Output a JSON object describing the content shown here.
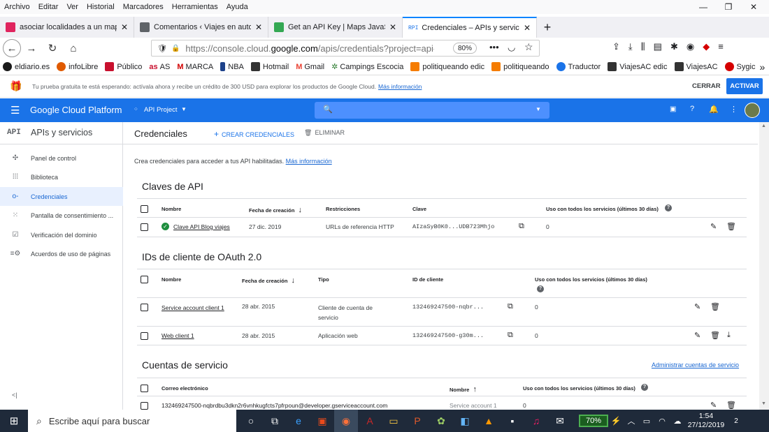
{
  "menubar": [
    "Archivo",
    "Editar",
    "Ver",
    "Historial",
    "Marcadores",
    "Herramientas",
    "Ayuda"
  ],
  "tabs": [
    {
      "label": "asociar localidades a un mapa d",
      "icon": "wp-icon",
      "color": "#e0245e"
    },
    {
      "label": "Comentarios ‹ Viajes en autoca",
      "icon": "blog-icon",
      "color": "#5f6368"
    },
    {
      "label": "Get an API Key  |  Maps JavaScr",
      "icon": "maps-icon",
      "color": "#34a853"
    },
    {
      "label": "Credenciales – APIs y servicios",
      "icon": "api-icon",
      "color": "#1a73e8",
      "prefix": "RPI"
    }
  ],
  "url": {
    "prefix": "https://console.cloud.",
    "domain": "google.com",
    "rest": "/apis/credentials?project=api-pro"
  },
  "zoom": "80%",
  "bookmarks": [
    {
      "label": "eldiario.es",
      "color": "#1a1a1a"
    },
    {
      "label": "infoLibre",
      "color": "#e05a00"
    },
    {
      "label": "Público",
      "color": "#c8102e"
    },
    {
      "label": "AS",
      "color": "#c8102e",
      "prefix": "as"
    },
    {
      "label": "MARCA",
      "color": "#d10000"
    },
    {
      "label": "NBA",
      "color": "#1d428a"
    },
    {
      "label": "Hotmail",
      "color": "#333"
    },
    {
      "label": "Gmail",
      "color": "#ea4335"
    },
    {
      "label": "Campings Escocia",
      "color": "#2e7d32"
    },
    {
      "label": "politiqueando edic",
      "color": "#f57c00"
    },
    {
      "label": "politiqueando",
      "color": "#f57c00"
    },
    {
      "label": "Traductor",
      "color": "#1a73e8"
    },
    {
      "label": "ViajesAC edic",
      "color": "#333"
    },
    {
      "label": "ViajesAC",
      "color": "#333"
    },
    {
      "label": "Sygic",
      "color": "#d50000"
    }
  ],
  "trial": {
    "text": "Tu prueba gratuita te está esperando: actívala ahora y recibe un crédito de 300 USD para explorar los productos de Google Cloud.",
    "link": "Más información",
    "close": "CERRAR",
    "activate": "ACTIVAR"
  },
  "gcp": {
    "brand": "Google Cloud Platform",
    "project": "API Project"
  },
  "sidebar": {
    "badge": "API",
    "title": "APIs y servicios",
    "items": [
      {
        "label": "Panel de control",
        "icon": "✣"
      },
      {
        "label": "Biblioteca",
        "icon": "⁞⁞⁞"
      },
      {
        "label": "Credenciales",
        "icon": "o-"
      },
      {
        "label": "Pantalla de consentimiento ...",
        "icon": "⁙"
      },
      {
        "label": "Verificación del dominio",
        "icon": "☑"
      },
      {
        "label": "Acuerdos de uso de páginas",
        "icon": "≡⚙"
      }
    ],
    "collapse": "<|"
  },
  "main": {
    "title": "Credenciales",
    "create": "CREAR CREDENCIALES",
    "delete": "ELIMINAR",
    "intro": "Crea credenciales para acceder a tus API habilitadas.",
    "intro_link": "Más información",
    "api_keys": {
      "heading": "Claves de API",
      "headers": [
        "Nombre",
        "Fecha de creación",
        "Restricciones",
        "Clave",
        "Uso con todos los servicios (últimos 30 días)"
      ],
      "rows": [
        {
          "name": "Clave API Blog viajes",
          "date": "27 dic. 2019",
          "restriction": "URLs de referencia HTTP",
          "key": "AIzaSyB0K0...UDB723Mhjo",
          "usage": "0"
        }
      ]
    },
    "oauth": {
      "heading": "IDs de cliente de OAuth 2.0",
      "headers": [
        "Nombre",
        "Fecha de creación",
        "Tipo",
        "ID de cliente",
        "Uso con todos los servicios (últimos 30 días)"
      ],
      "rows": [
        {
          "name": "Service account client 1",
          "date": "28 abr. 2015",
          "type": "Cliente de cuenta de servicio",
          "id": "132469247500-nqbr...",
          "usage": "0"
        },
        {
          "name": "Web client 1",
          "date": "28 abr. 2015",
          "type": "Aplicación web",
          "id": "132469247500-g30m...",
          "usage": "0"
        }
      ]
    },
    "service": {
      "heading": "Cuentas de servicio",
      "manage": "Administrar cuentas de servicio",
      "headers": [
        "Correo electrónico",
        "Nombre",
        "Uso con todos los servicios (últimos 30 días)"
      ],
      "rows": [
        {
          "email": "132469247500-nqbrdbu3dkn2r6vnhkugfcts7pfrpoun@developer.gserviceaccount.com",
          "name": "Service account 1",
          "usage": "0"
        }
      ]
    }
  },
  "taskbar": {
    "search": "Escribe aquí para buscar",
    "battery": "70%",
    "time": "1:54",
    "date": "27/12/2019",
    "notifications": "2"
  }
}
